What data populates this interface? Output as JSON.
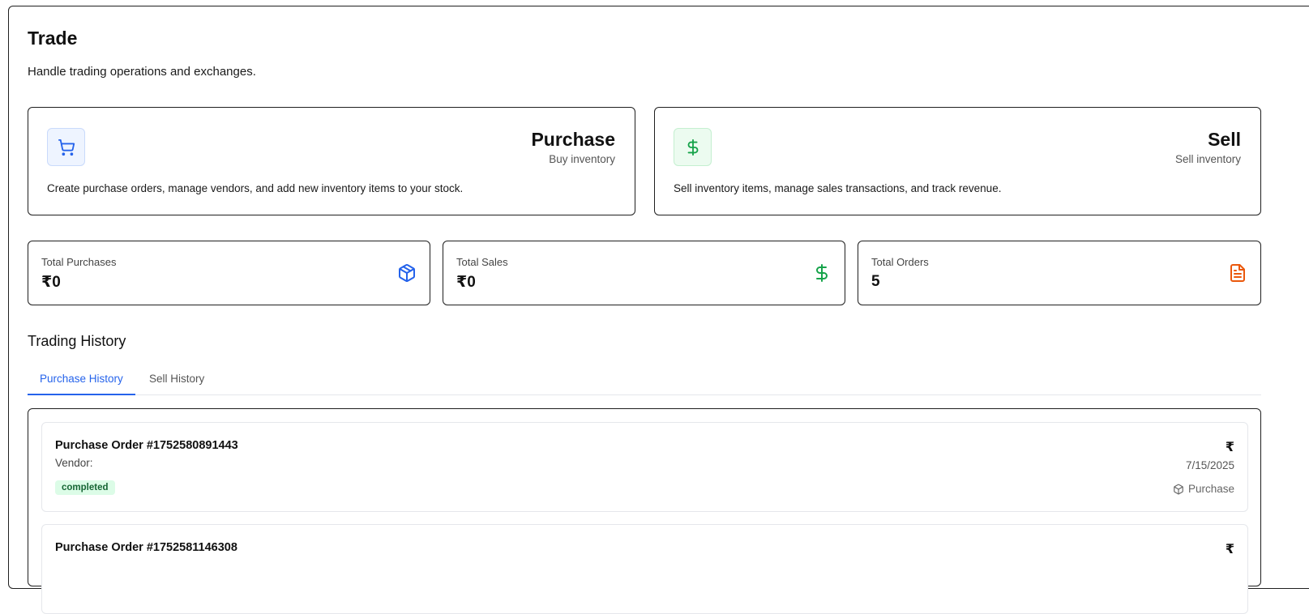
{
  "page": {
    "title": "Trade",
    "subtitle": "Handle trading operations and exchanges."
  },
  "actions": {
    "purchase": {
      "icon": "shopping-cart-icon",
      "title": "Purchase",
      "subtitle": "Buy inventory",
      "description": "Create purchase orders, manage vendors, and add new inventory items to your stock."
    },
    "sell": {
      "icon": "dollar-sign-icon",
      "title": "Sell",
      "subtitle": "Sell inventory",
      "description": "Sell inventory items, manage sales transactions, and track revenue."
    }
  },
  "stats": [
    {
      "label": "Total Purchases",
      "value": "₹0",
      "icon": "package-icon",
      "color": "#2563eb"
    },
    {
      "label": "Total Sales",
      "value": "₹0",
      "icon": "dollar-sign-icon",
      "color": "#16a34a"
    },
    {
      "label": "Total Orders",
      "value": "5",
      "icon": "file-text-icon",
      "color": "#ea580c"
    }
  ],
  "history": {
    "title": "Trading History",
    "tabs": [
      {
        "label": "Purchase History",
        "active": true
      },
      {
        "label": "Sell History",
        "active": false
      }
    ],
    "orders": [
      {
        "title": "Purchase Order #1752580891443",
        "vendor": "Vendor:",
        "status": "completed",
        "amount": "₹",
        "date": "7/15/2025",
        "type": "Purchase"
      },
      {
        "title": "Purchase Order #1752581146308",
        "amount": "₹"
      }
    ]
  },
  "colors": {
    "accent": "#2563eb",
    "success": "#16a34a",
    "warning": "#ea580c",
    "badge_bg": "#dcfce7"
  }
}
